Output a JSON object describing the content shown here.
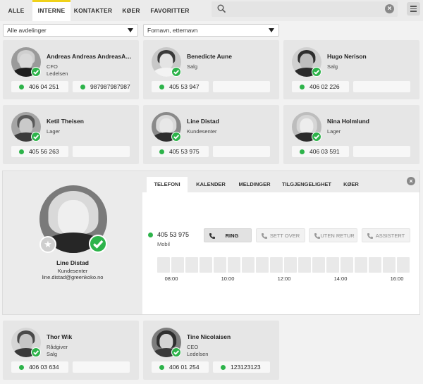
{
  "nav": {
    "tabs": [
      {
        "label": "ALLE"
      },
      {
        "label": "INTERNE"
      },
      {
        "label": "KONTAKTER"
      },
      {
        "label": "KØER"
      },
      {
        "label": "FAVORITTER"
      }
    ],
    "active_tab": "INTERNE",
    "search": {
      "value": "",
      "placeholder": ""
    }
  },
  "filters": {
    "department": "Alle avdelinger",
    "sort": "Fornavn, etternavn"
  },
  "colors": {
    "accent": "#f0d21a",
    "status_available": "#2db34a"
  },
  "contacts": [
    {
      "name": "Andreas Andreas AndreasAndreas",
      "role": "CFO",
      "dept": "Ledelsen",
      "phones": [
        "406 04 251",
        "987987987987"
      ]
    },
    {
      "name": "Benedicte Aune",
      "role": "Salg",
      "dept": "",
      "phones": [
        "405 53 947",
        ""
      ]
    },
    {
      "name": "Hugo Nerison",
      "role": "Salg",
      "dept": "",
      "phones": [
        "406 02 226",
        ""
      ]
    },
    {
      "name": "Ketil Theisen",
      "role": "Lager",
      "dept": "",
      "phones": [
        "405 56 263",
        ""
      ]
    },
    {
      "name": "Line Distad",
      "role": "Kundesenter",
      "dept": "",
      "phones": [
        "405 53 975",
        ""
      ]
    },
    {
      "name": "Nina Holmlund",
      "role": "Lager",
      "dept": "",
      "phones": [
        "406 03 591",
        ""
      ]
    },
    {
      "name": "Thor Wik",
      "role": "Rådgiver",
      "dept": "Salg",
      "phones": [
        "406 03 634",
        ""
      ]
    },
    {
      "name": "Tine Nicolaisen",
      "role": "CEO",
      "dept": "Ledelsen",
      "phones": [
        "406 01 254",
        "123123123"
      ]
    }
  ],
  "detail": {
    "name": "Line Distad",
    "role": "Kundesenter",
    "email": "line.distad@greenkoko.no",
    "tabs": [
      "TELEFONI",
      "KALENDER",
      "MELDINGER",
      "TILGJENGELIGHET",
      "KØER"
    ],
    "active_tab": "TELEFONI",
    "number": "405 53 975",
    "number_type": "Mobil",
    "actions": [
      "RING",
      "SETT OVER",
      "UTEN RETUR",
      "ASSISTERT"
    ],
    "timeline": [
      "08:00",
      "10:00",
      "12:00",
      "14:00",
      "16:00"
    ]
  },
  "icons": {
    "search": "magnifier-icon",
    "clear": "clear-icon",
    "menu": "hamburger-icon",
    "status": "check-icon",
    "favorite": "star-icon",
    "call": "phone-icon",
    "close": "close-icon"
  }
}
